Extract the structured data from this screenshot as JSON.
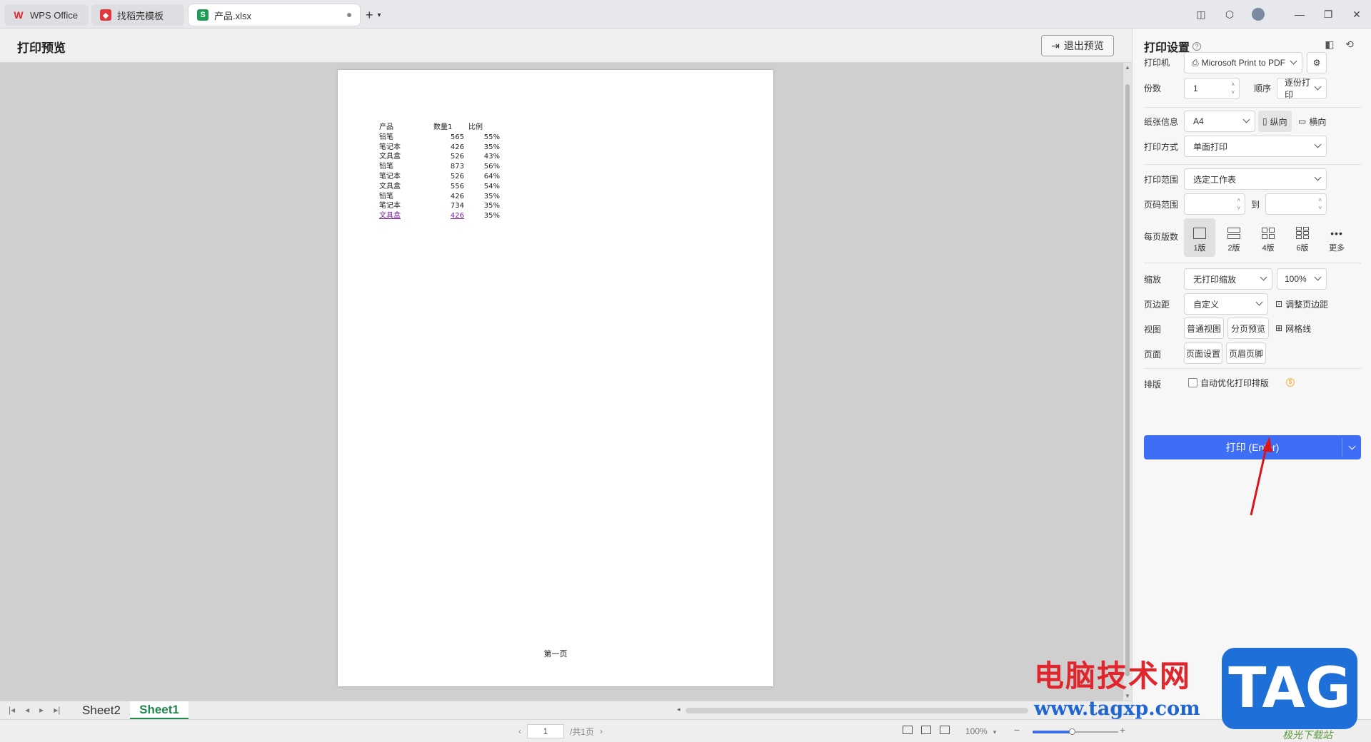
{
  "tabs": [
    {
      "label": "WPS Office",
      "icon": "wps-logo-icon"
    },
    {
      "label": "找稻壳模板",
      "icon": "docer-logo-icon"
    },
    {
      "label": "产品.xlsx",
      "icon": "spreadsheet-s-icon",
      "logo_letter": "S"
    }
  ],
  "header": {
    "title": "打印预览",
    "exit_label": "退出预览"
  },
  "sheet_table": {
    "headers": [
      "产品",
      "数量1",
      "比例"
    ],
    "rows": [
      [
        "铅笔",
        "565",
        "55%"
      ],
      [
        "笔记本",
        "426",
        "35%"
      ],
      [
        "文具盒",
        "526",
        "43%"
      ],
      [
        "铅笔",
        "873",
        "56%"
      ],
      [
        "笔记本",
        "526",
        "64%"
      ],
      [
        "文具盒",
        "556",
        "54%"
      ],
      [
        "铅笔",
        "426",
        "35%"
      ],
      [
        "笔记本",
        "734",
        "35%"
      ],
      [
        "文具盒",
        "426",
        "35%"
      ]
    ]
  },
  "page_footer": "第一页",
  "sheet_tabs": [
    "Sheet2",
    "Sheet1"
  ],
  "status": {
    "page_current": "1",
    "page_total": "/共1页",
    "zoom": "100%",
    "zoom_fraction": 0.46
  },
  "panel": {
    "title": "打印设置",
    "printer_label": "打印机",
    "printer_value": "Microsoft Print to PDF",
    "copies_label": "份数",
    "copies_value": "1",
    "order_label": "顺序",
    "order_value": "逐份打印",
    "paper_label": "纸张信息",
    "paper_value": "A4",
    "portrait_label": "纵向",
    "landscape_label": "横向",
    "mode_label": "打印方式",
    "mode_value": "单面打印",
    "range_label": "打印范围",
    "range_value": "选定工作表",
    "pages_label": "页码范围",
    "pages_to": "到",
    "per_page_label": "每页版数",
    "layouts": [
      "1版",
      "2版",
      "4版",
      "6版",
      "更多"
    ],
    "scale_label": "缩放",
    "scale_value": "无打印缩放",
    "scale_percent": "100%",
    "margin_label": "页边距",
    "margin_value": "自定义",
    "adjust_margin": "调整页边距",
    "view_label": "视图",
    "normal_view": "普通视图",
    "page_break": "分页预览",
    "gridlines": "网格线",
    "page_label": "页面",
    "page_setup": "页面设置",
    "header_footer": "页眉页脚",
    "arrange_label": "排版",
    "auto_optimize": "自动优化打印排版",
    "print_button": "打印 (Enter)"
  },
  "watermark": {
    "cn": "电脑技术网",
    "url": "www.tagxp.com",
    "tag": "TAG",
    "small": "极光下载站"
  },
  "colors": {
    "accent": "#3d6ef5",
    "sheet_green": "#1f8a4c",
    "link_purple": "#7a1fa2",
    "arrow_red": "#d8161b"
  }
}
